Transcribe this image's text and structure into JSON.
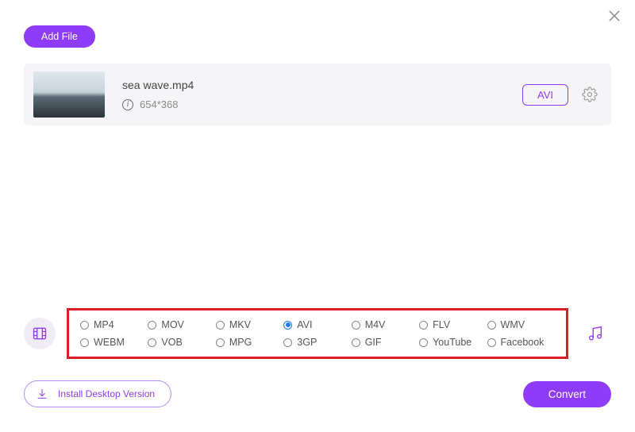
{
  "header": {
    "add_file_label": "Add File"
  },
  "file": {
    "name": "sea wave.mp4",
    "dimensions": "654*368",
    "target_format": "AVI"
  },
  "formats": {
    "row1": [
      "MP4",
      "MOV",
      "MKV",
      "AVI",
      "M4V",
      "FLV",
      "WMV"
    ],
    "row2": [
      "WEBM",
      "VOB",
      "MPG",
      "3GP",
      "GIF",
      "YouTube",
      "Facebook"
    ],
    "selected": "AVI"
  },
  "footer": {
    "install_label": "Install Desktop Version",
    "convert_label": "Convert"
  },
  "colors": {
    "accent": "#8e3cf7",
    "highlight_border": "#d9201f",
    "radio_selected": "#1d7cf2"
  }
}
